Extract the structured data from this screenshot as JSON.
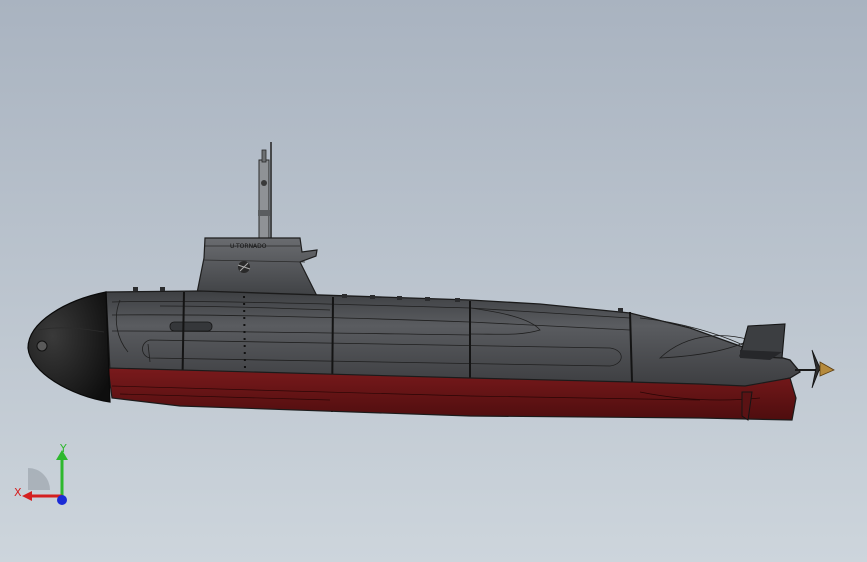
{
  "viewport": {
    "background_top": "#a9b3c0",
    "background_bottom": "#cdd5dc",
    "model": {
      "hull_color": "#4d4f52",
      "hull_dark": "#2b2c2e",
      "bottom_color": "#6b1416",
      "nose_color": "#1a1a1a",
      "sail_text": "U-TORNADO"
    }
  },
  "triad": {
    "x_label": "X",
    "y_label": "Y",
    "x_color": "#d42020",
    "y_color": "#2eb82e",
    "z_color": "#1a2bd6"
  }
}
